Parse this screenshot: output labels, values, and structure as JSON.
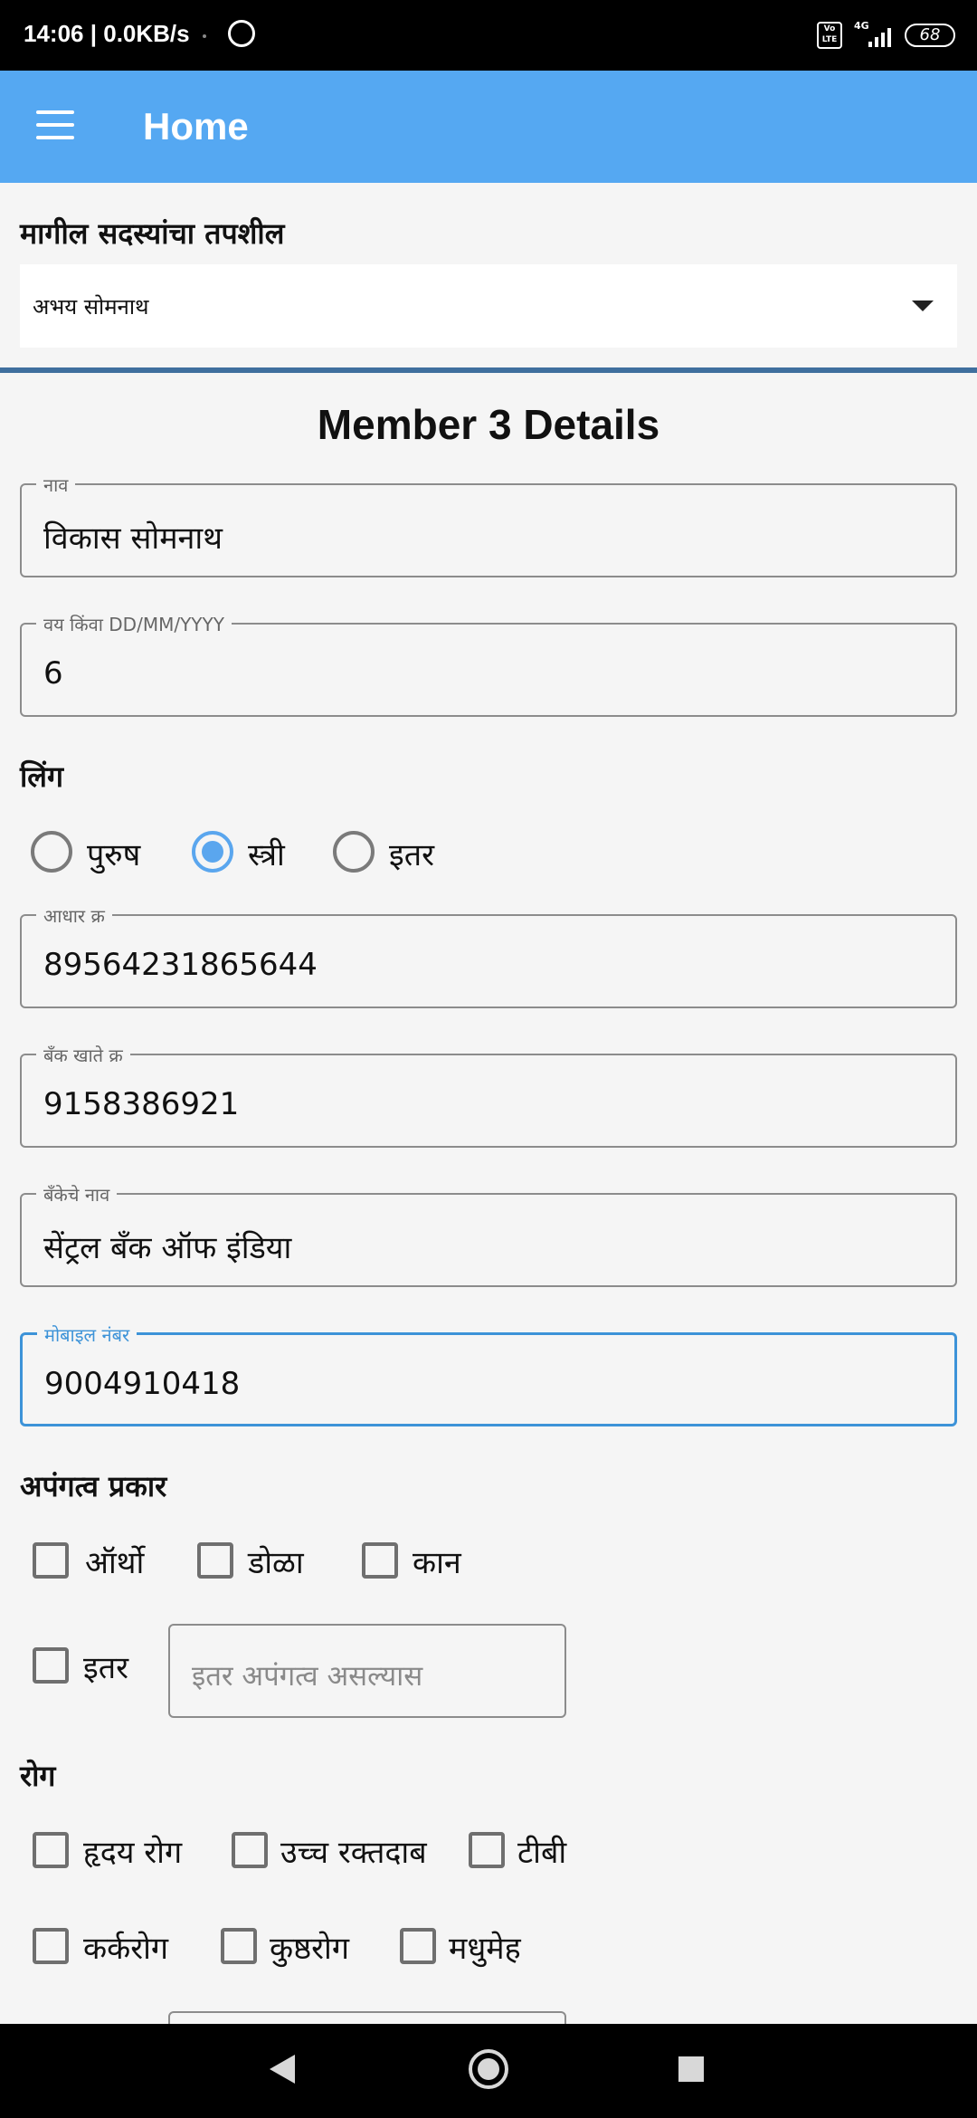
{
  "status_bar": {
    "time": "14:06",
    "speed": "0.0KB/s",
    "volte": "Vo LTE",
    "network": "4G",
    "battery": "68"
  },
  "appbar": {
    "title": "Home"
  },
  "previous_members": {
    "heading": "मागील सदस्यांचा तपशील",
    "selected": "अभय सोमनाथ"
  },
  "member_title": "Member 3 Details",
  "fields": {
    "name": {
      "label": "नाव",
      "value": "विकास सोमनाथ"
    },
    "age": {
      "label": "वय किंवा DD/MM/YYYY",
      "value": "6"
    },
    "aadhar": {
      "label": "आधार क्र",
      "value": "89564231865644"
    },
    "bank_account": {
      "label": "बँक खाते क्र",
      "value": "9158386921"
    },
    "bank_name": {
      "label": "बँकेचे नाव",
      "value": "सेंट्रल बँक ऑफ इंडिया"
    },
    "mobile": {
      "label": "मोबाइल नंबर",
      "value": "9004910418"
    }
  },
  "gender": {
    "heading": "लिंग",
    "options": [
      "पुरुष",
      "स्त्री",
      "इतर"
    ],
    "selected": "स्त्री"
  },
  "disability": {
    "heading": "अपंगत्व प्रकार",
    "options": [
      "ऑर्थो",
      "डोळा",
      "कान",
      "इतर"
    ],
    "other_placeholder": "इतर अपंगत्व असल्यास"
  },
  "disease": {
    "heading": "रोग",
    "options": [
      "हृदय रोग",
      "उच्च रक्तदाब",
      "टीबी",
      "कर्करोग",
      "कुष्ठरोग",
      "मधुमेह"
    ]
  }
}
